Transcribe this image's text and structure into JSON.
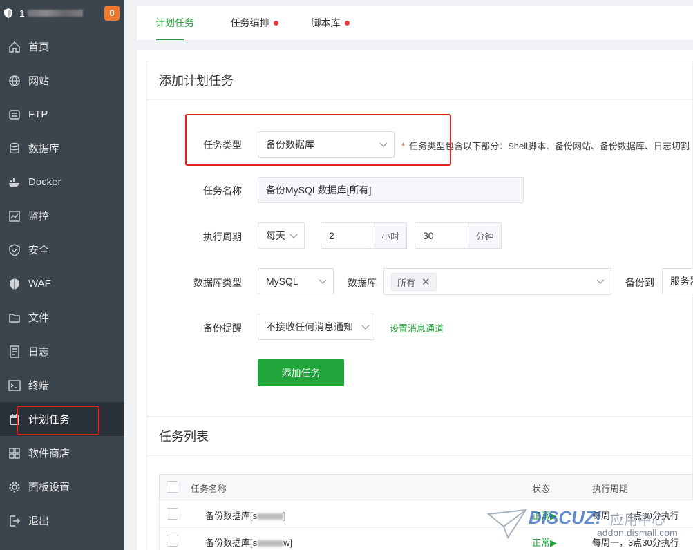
{
  "sidebar": {
    "server_label": "1",
    "alerts_count": "0",
    "items": [
      {
        "label": "首页",
        "icon": "home-icon"
      },
      {
        "label": "网站",
        "icon": "globe-icon"
      },
      {
        "label": "FTP",
        "icon": "ftp-icon"
      },
      {
        "label": "数据库",
        "icon": "database-icon"
      },
      {
        "label": "Docker",
        "icon": "docker-icon"
      },
      {
        "label": "监控",
        "icon": "monitor-icon"
      },
      {
        "label": "安全",
        "icon": "shield-icon"
      },
      {
        "label": "WAF",
        "icon": "waf-shield-icon"
      },
      {
        "label": "文件",
        "icon": "folder-icon"
      },
      {
        "label": "日志",
        "icon": "log-icon"
      },
      {
        "label": "终端",
        "icon": "terminal-icon"
      },
      {
        "label": "计划任务",
        "icon": "calendar-icon"
      },
      {
        "label": "软件商店",
        "icon": "apps-icon"
      },
      {
        "label": "面板设置",
        "icon": "gear-icon"
      },
      {
        "label": "退出",
        "icon": "logout-icon"
      }
    ]
  },
  "tabs": [
    {
      "label": "计划任务"
    },
    {
      "label": "任务编排"
    },
    {
      "label": "脚本库"
    }
  ],
  "form": {
    "title": "添加计划任务",
    "task_type_label": "任务类型",
    "task_type_value": "备份数据库",
    "task_type_hint": "任务类型包含以下部分：Shell脚本、备份网站、备份数据库、日志切割",
    "task_name_label": "任务名称",
    "task_name_value": "备份MySQL数据库[所有]",
    "period_label": "执行周期",
    "period_value": "每天",
    "hour_value": "2",
    "hour_unit": "小时",
    "minute_value": "30",
    "minute_unit": "分钟",
    "db_type_label": "数据库类型",
    "db_type_value": "MySQL",
    "db_label": "数据库",
    "db_selected": "所有",
    "backup_to_label": "备份到",
    "backup_to_value": "服务器",
    "notify_label": "备份提醒",
    "notify_value": "不接收任何消息通知",
    "notify_link": "设置消息通道",
    "submit_label": "添加任务"
  },
  "list": {
    "title": "任务列表",
    "columns": [
      "任务名称",
      "状态",
      "执行周期"
    ],
    "rows": [
      {
        "name_prefix": "备份数据库[s",
        "name_suffix": "]",
        "status": "正常▶",
        "period": "每周一，4点30分执行"
      },
      {
        "name_prefix": "备份数据库[s",
        "name_suffix": "w]",
        "status": "正常▶",
        "period": "每周一，3点30分执行"
      }
    ]
  },
  "watermark": {
    "brand": "DISCUZ!",
    "sub": "应用中心",
    "url": "addon.dismall.com"
  },
  "colors": {
    "sidebar_bg": "#3c444d",
    "accent": "#20a53a",
    "badge": "#f0782d",
    "highlight_box": "#e0231c"
  }
}
